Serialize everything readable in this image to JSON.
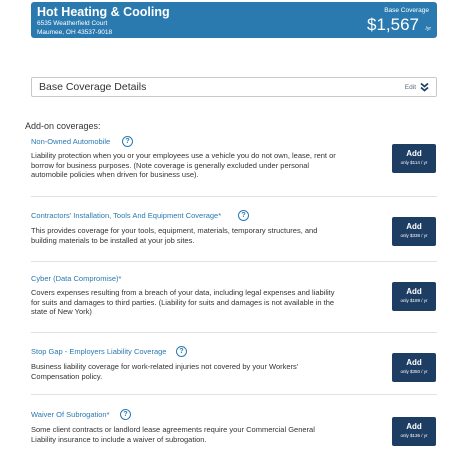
{
  "business": {
    "name": "Hot Heating & Cooling",
    "address_line1": "6535 Weatherfield Court",
    "address_line2": "Maumee, OH 43537-9018"
  },
  "base_coverage": {
    "label": "Base Coverage",
    "price": "$1,567",
    "period": "/yr"
  },
  "base_details": {
    "title": "Base Coverage Details",
    "edit_label": "Edit"
  },
  "addons": {
    "heading": "Add-on coverages:",
    "items": [
      {
        "title": "Non-Owned Automobile",
        "star": "",
        "description": "Liability protection when you or your employees use a vehicle you do not own, lease, rent or borrow for business purposes. (Note coverage is generally excluded under personal automobile policies when driven for business use).",
        "button_label": "Add",
        "button_price": "only $114 / yr"
      },
      {
        "title": "Contractors' Installation, Tools And Equipment Coverage",
        "star": "*",
        "description": "This provides coverage for your tools, equipment, materials, temporary structures, and building materials to be installed at your job sites.",
        "button_label": "Add",
        "button_price": "only $338 / yr"
      },
      {
        "title": "Cyber (Data Compromise)",
        "star": "*",
        "description": "Covers expenses resulting from a breach of your data, including legal expenses and liability for suits and damages to third parties. (Liability for suits and damages is not available in the state of New York)",
        "button_label": "Add",
        "button_price": "only $189 / yr"
      },
      {
        "title": "Stop Gap - Employers Liability Coverage",
        "star": "",
        "description": "Business liability coverage for work-related injuries not covered by your Workers' Compensation policy.",
        "button_label": "Add",
        "button_price": "only $350 / yr"
      },
      {
        "title": "Waiver Of Subrogation",
        "star": "*",
        "description": "Some client contracts or landlord lease agreements require your Commercial General Liability insurance to include a waiver of subrogation.",
        "button_label": "Add",
        "button_price": "only $136 / yr"
      }
    ]
  },
  "icons": {
    "help": "question-circle-icon",
    "expand": "double-chevron-down-icon"
  },
  "colors": {
    "header_bg": "#2a7ab0",
    "button_bg": "#1d3d63",
    "link_blue": "#2a7ab0"
  }
}
